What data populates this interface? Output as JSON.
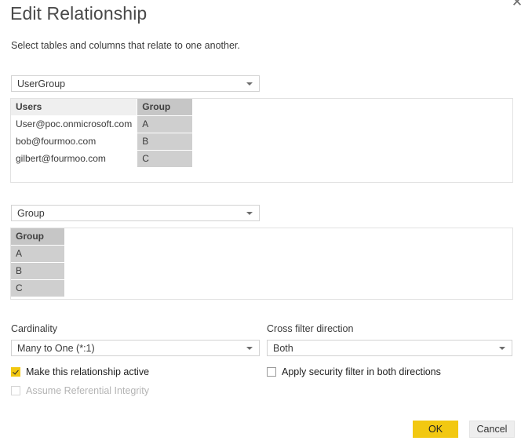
{
  "dialog": {
    "title": "Edit Relationship",
    "subtitle": "Select tables and columns that relate to one another.",
    "close_label": "✕"
  },
  "relationship": {
    "from": {
      "table_select": {
        "value": "UserGroup"
      },
      "preview": {
        "columns": [
          {
            "name": "Users",
            "selected": false
          },
          {
            "name": "Group",
            "selected": true
          }
        ],
        "rows": [
          [
            "User@poc.onmicrosoft.com",
            "A"
          ],
          [
            "bob@fourmoo.com",
            "B"
          ],
          [
            "gilbert@fourmoo.com",
            "C"
          ]
        ]
      }
    },
    "to": {
      "table_select": {
        "value": "Group"
      },
      "preview": {
        "columns": [
          {
            "name": "Group",
            "selected": true
          }
        ],
        "rows": [
          [
            "A"
          ],
          [
            "B"
          ],
          [
            "C"
          ]
        ]
      }
    }
  },
  "options": {
    "cardinality": {
      "label": "Cardinality",
      "value": "Many to One (*:1)"
    },
    "cross_filter": {
      "label": "Cross filter direction",
      "value": "Both"
    },
    "make_active": {
      "label": "Make this relationship active",
      "checked": true,
      "disabled": false
    },
    "assume_referential_integrity": {
      "label": "Assume Referential Integrity",
      "checked": false,
      "disabled": true
    },
    "apply_security_filter": {
      "label": "Apply security filter in both directions",
      "checked": false,
      "disabled": false
    }
  },
  "footer": {
    "ok_label": "OK",
    "cancel_label": "Cancel"
  },
  "colors": {
    "accent": "#f2c811",
    "selected_cell": "#cfcfcf",
    "selected_header": "#c6c6c6"
  }
}
